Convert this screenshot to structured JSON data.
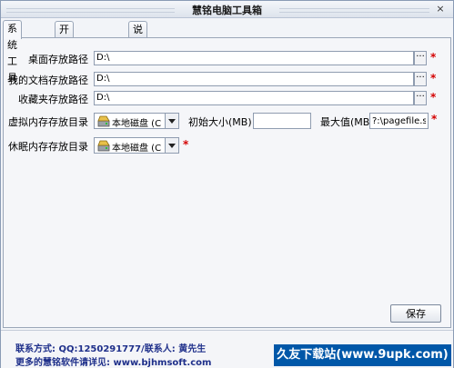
{
  "window": {
    "title": "慧铭电脑工具箱",
    "close_glyph": "×"
  },
  "tabs": [
    {
      "label": "系统工具",
      "active": true
    },
    {
      "label": "开机运行列表",
      "active": false
    },
    {
      "label": "说明",
      "active": false
    }
  ],
  "paths": [
    {
      "label": "桌面存放路径",
      "value": "D:\\"
    },
    {
      "label": "我的文档存放路径",
      "value": "D:\\"
    },
    {
      "label": "收藏夹存放路径",
      "value": "D:\\"
    }
  ],
  "browse_glyph": "···",
  "required_mark": "*",
  "virtual_memory": {
    "label": "虚拟内存存放目录",
    "drive_selected": "本地磁盘 (C",
    "initial_label": "初始大小(MB)",
    "initial_value": "",
    "max_label": "最大值(MB)",
    "max_value": "?:\\pagefile.sys"
  },
  "hibernate": {
    "label": "休眠内存存放目录",
    "drive_selected": "本地磁盘 (C"
  },
  "buttons": {
    "save": "保存"
  },
  "footer": {
    "contact": "联系方式: QQ:1250291777/联系人: 黄先生",
    "more": "更多的慧铭软件请详见: www.bjhmsoft.com",
    "watermark": "久友下载站(www.9upk.com)"
  },
  "colors": {
    "accent": "#1e2f8a",
    "required": "#d40000",
    "watermark_bg": "#0057a8"
  },
  "icons": {
    "drive": "hard-drive-icon",
    "dropdown": "chevron-down-icon",
    "browse": "ellipsis-icon"
  }
}
